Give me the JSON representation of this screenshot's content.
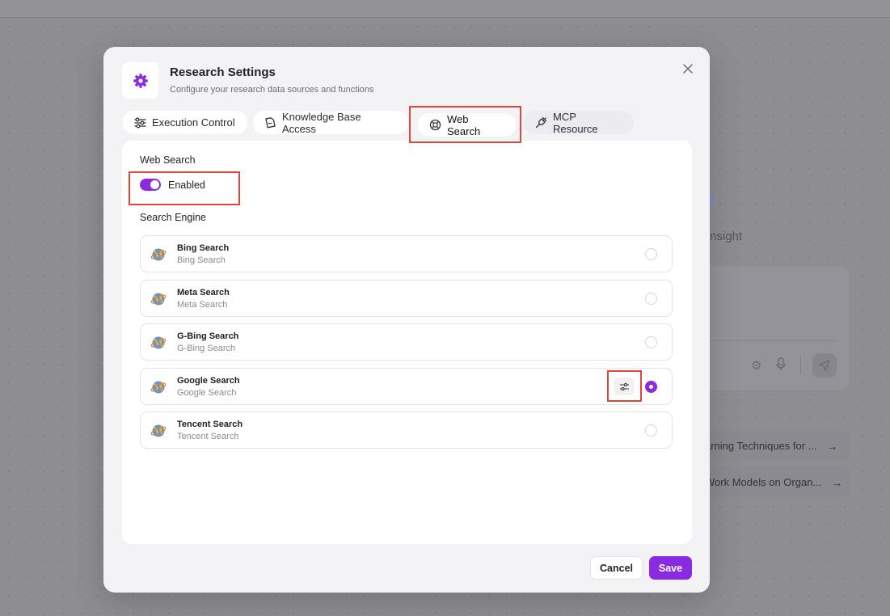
{
  "background": {
    "insight_text": "Insight",
    "suggestions": [
      "arning Techniques for ...",
      "Work Models on Organ..."
    ]
  },
  "modal": {
    "title": "Research Settings",
    "subtitle": "Configure your research data sources and functions",
    "tabs": [
      {
        "label": "Execution Control",
        "icon": "sliders-icon"
      },
      {
        "label": "Knowledge Base Access",
        "icon": "document-icon"
      },
      {
        "label": "Web Search",
        "icon": "lifebuoy-icon"
      },
      {
        "label": "MCP Resource",
        "icon": "plug-icon"
      }
    ],
    "active_tab": "Web Search",
    "web_search": {
      "heading": "Web Search",
      "toggle_label": "Enabled",
      "enabled": true,
      "engine_heading": "Search Engine",
      "engines": [
        {
          "name": "Bing Search",
          "desc": "Bing Search",
          "selected": false
        },
        {
          "name": "Meta Search",
          "desc": "Meta Search",
          "selected": false
        },
        {
          "name": "G-Bing Search",
          "desc": "G-Bing Search",
          "selected": false
        },
        {
          "name": "Google Search",
          "desc": "Google Search",
          "selected": true
        },
        {
          "name": "Tencent Search",
          "desc": "Tencent Search",
          "selected": false
        }
      ]
    },
    "buttons": {
      "cancel": "Cancel",
      "save": "Save"
    },
    "accent_color": "#8a2be2",
    "highlight_color": "#e0453a"
  }
}
